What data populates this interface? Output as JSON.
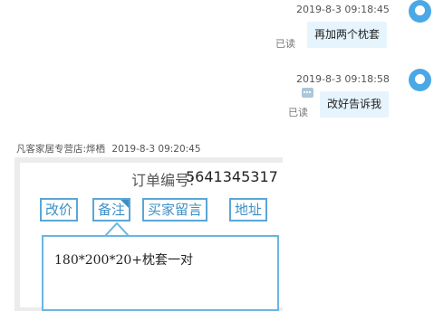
{
  "messages": [
    {
      "timestamp": "2019-8-3 09:18:45",
      "read_status": "已读",
      "text": "再加两个枕套"
    },
    {
      "timestamp": "2019-8-3 09:18:58",
      "read_status": "已读",
      "text": "改好告诉我"
    }
  ],
  "seller": {
    "name_line": "凡客家居专营店:烨栖",
    "timestamp": "2019-8-3 09:20:45"
  },
  "order_card": {
    "order_label": "订单编号:",
    "order_number": "5641345317",
    "buttons": [
      "改价",
      "备注",
      "买家留言",
      "地址"
    ],
    "note_text": "180*200*20+枕套一对"
  },
  "colors": {
    "bubble_bg": "#e6f4fd",
    "avatar": "#4aa8e6",
    "accent": "#3b8fc7"
  }
}
